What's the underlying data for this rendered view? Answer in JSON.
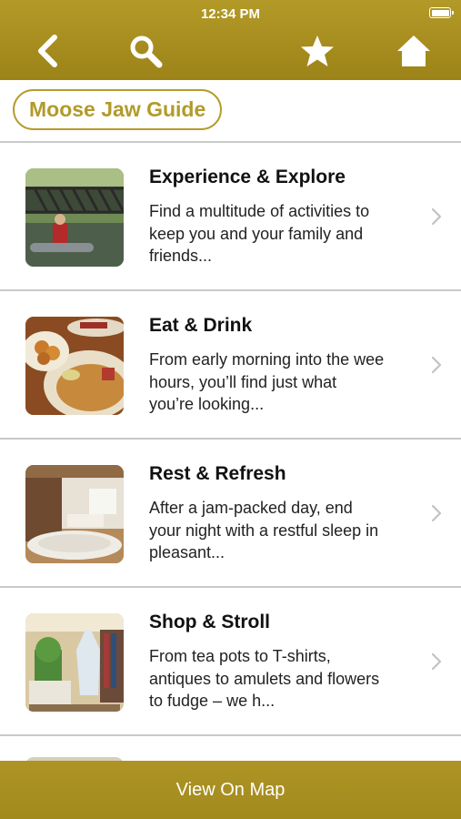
{
  "status_bar": {
    "time": "12:34 PM"
  },
  "nav": {
    "back_icon": "chevron-left-icon",
    "search_icon": "search-icon",
    "favorites_icon": "star-icon",
    "home_icon": "home-icon"
  },
  "guide_label": "Moose Jaw Guide",
  "colors": {
    "accent": "#b39a28",
    "text": "#111111"
  },
  "categories": [
    {
      "title": "Experience & Explore",
      "description": "Find a multitude of activities to keep you and your family and friends...",
      "image": "bridge-kayak-photo"
    },
    {
      "title": "Eat & Drink",
      "description": "From early morning into the wee hours, you’ll find just what you’re looking...",
      "image": "food-platter-photo"
    },
    {
      "title": "Rest & Refresh",
      "description": "After a jam-packed day, end your night with a restful sleep in pleasant...",
      "image": "hotel-room-photo"
    },
    {
      "title": "Shop & Stroll",
      "description": "From tea pots to T-shirts, antiques to amulets and flowers to fudge – we h...",
      "image": "boutique-shop-photo"
    }
  ],
  "bottom_bar": {
    "label": "View On Map"
  }
}
